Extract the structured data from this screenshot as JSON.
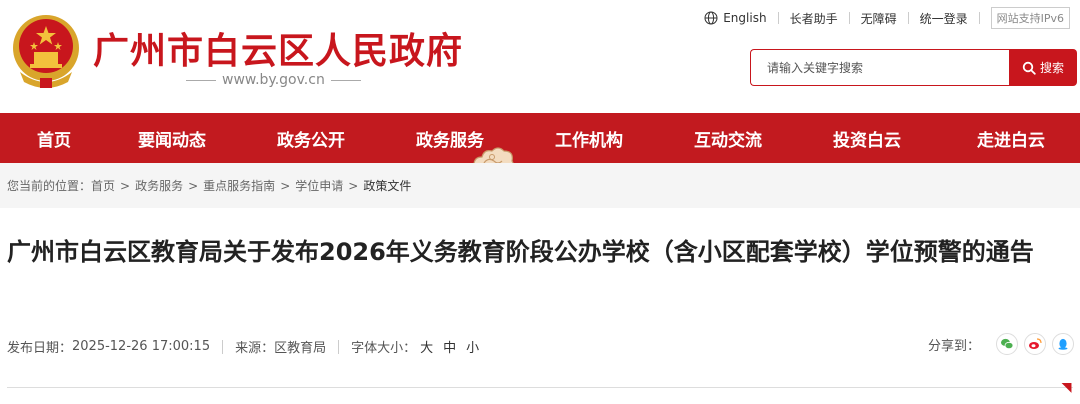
{
  "header": {
    "site_title": "广州市白云区人民政府",
    "site_url": "www.by.gov.cn",
    "top_links": [
      {
        "label": "English",
        "icon": "globe-icon"
      },
      {
        "label": "长者助手"
      },
      {
        "label": "无障碍"
      },
      {
        "label": "统一登录"
      }
    ],
    "ipv6_badge": "网站支持IPv6",
    "search": {
      "placeholder": "请输入关键字搜索",
      "button_label": "搜索"
    }
  },
  "nav": {
    "items": [
      "首页",
      "要闻动态",
      "政务公开",
      "政务服务",
      "工作机构",
      "互动交流",
      "投资白云",
      "走进白云"
    ],
    "active_index": 3
  },
  "breadcrumb": {
    "prefix": "您当前的位置：",
    "items": [
      "首页",
      "政务服务",
      "重点服务指南",
      "学位申请",
      "政策文件"
    ],
    "separator": ">"
  },
  "article": {
    "title": "广州市白云区教育局关于发布2026年义务教育阶段公办学校（含小区配套学校）学位预警的通告",
    "publish_label": "发布日期：",
    "publish_date": "2025-12-26 17:00:15",
    "source_label": "来源：",
    "source": "区教育局",
    "font_size_label": "字体大小：",
    "font_sizes": [
      "大",
      "中",
      "小"
    ],
    "share_label": "分享到："
  },
  "colors": {
    "brand_red": "#c8161d",
    "nav_red": "#c21a1f",
    "gold": "#e8b430"
  }
}
